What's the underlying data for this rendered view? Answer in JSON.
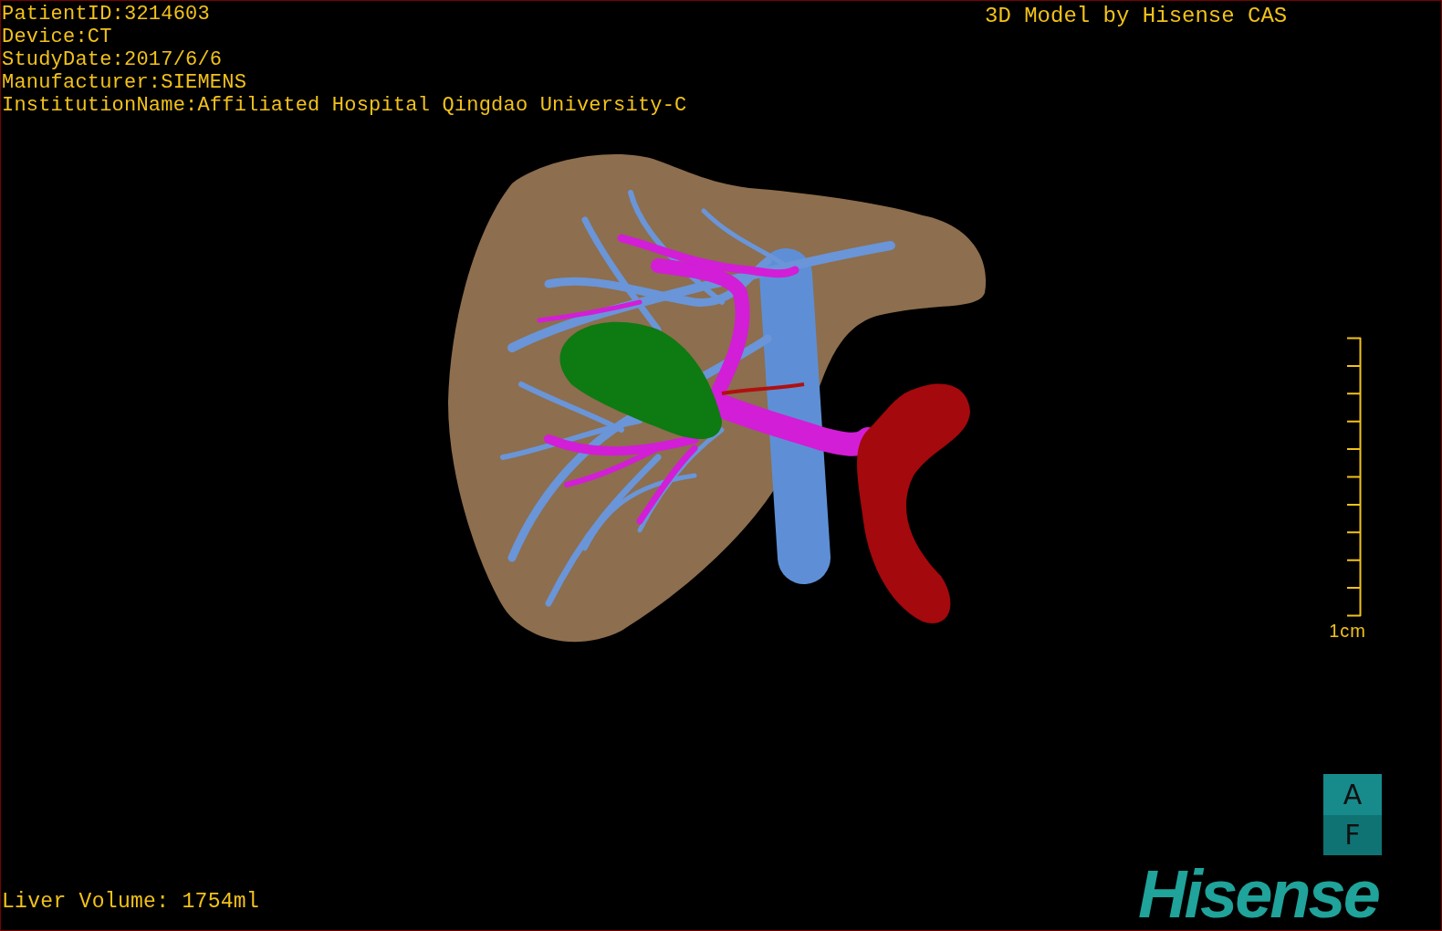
{
  "study_info": [
    "PatientID:3214603",
    "Device:CT",
    "StudyDate:2017/6/6",
    "Manufacturer:SIEMENS",
    "InstitutionName:Affiliated Hospital Qingdao University-C"
  ],
  "model_credit": "3D Model by Hisense CAS",
  "scale_bar": {
    "label": "1cm"
  },
  "orientation_cube": [
    "A",
    "F"
  ],
  "logo": "Hisense",
  "liver_volume": "Liver Volume: 1754ml"
}
